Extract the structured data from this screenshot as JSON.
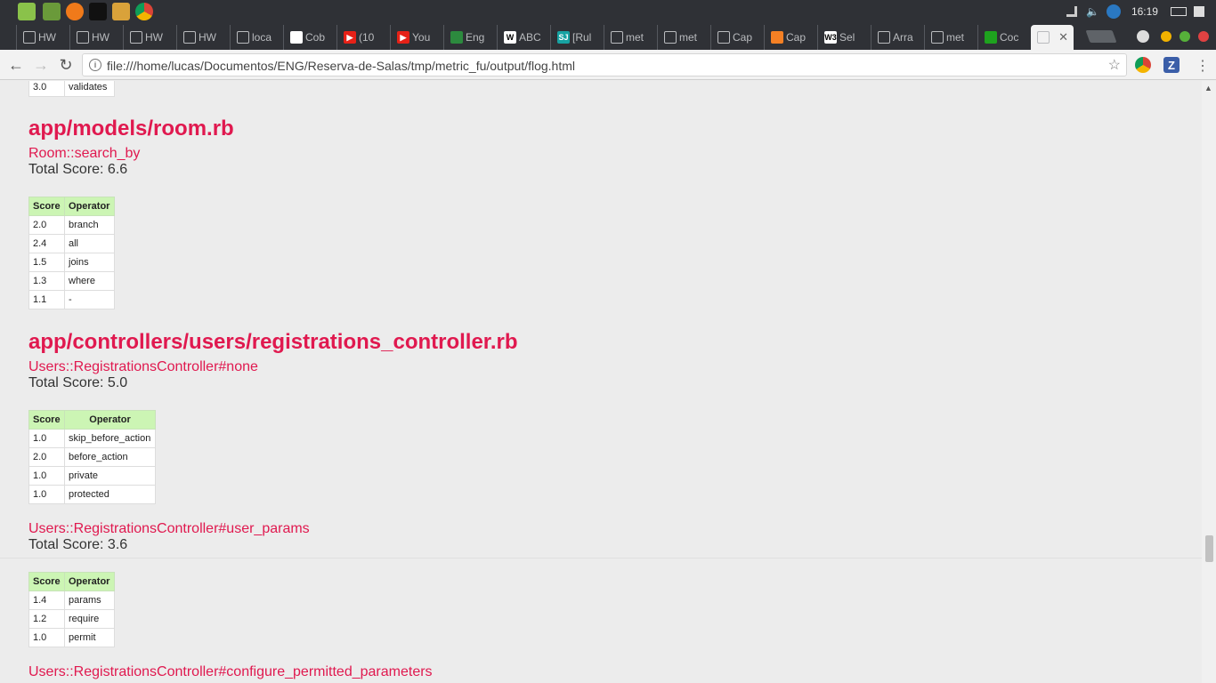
{
  "os": {
    "clock": "16:19",
    "apps": [
      "mint-menu-icon",
      "desktop-icon",
      "firefox-icon",
      "terminal-icon",
      "files-icon",
      "chrome-icon"
    ]
  },
  "tabs": [
    {
      "label": "HW",
      "icon": "doc-icon"
    },
    {
      "label": "HW",
      "icon": "doc-icon"
    },
    {
      "label": "HW",
      "icon": "doc-icon"
    },
    {
      "label": "HW",
      "icon": "doc-icon"
    },
    {
      "label": "loca",
      "icon": "doc-icon"
    },
    {
      "label": "Cob",
      "icon": "github-icon"
    },
    {
      "label": "(10",
      "icon": "youtube-icon"
    },
    {
      "label": "You",
      "icon": "youtube-icon"
    },
    {
      "label": "Eng",
      "icon": "flag-icon"
    },
    {
      "label": "ABC",
      "icon": "wikipedia-icon"
    },
    {
      "label": "[Rul",
      "icon": "sj-icon"
    },
    {
      "label": "met",
      "icon": "doc-icon"
    },
    {
      "label": "met",
      "icon": "doc-icon"
    },
    {
      "label": "Cap",
      "icon": "doc-icon"
    },
    {
      "label": "Cap",
      "icon": "stackoverflow-icon"
    },
    {
      "label": "Sel",
      "icon": "w3schools-icon"
    },
    {
      "label": "Arra",
      "icon": "doc-icon"
    },
    {
      "label": "met",
      "icon": "doc-icon"
    },
    {
      "label": "Coc",
      "icon": "green-square-icon"
    },
    {
      "label": "",
      "icon": "doc-icon"
    }
  ],
  "toolbar": {
    "url": "file:///home/lucas/Documentos/ENG/Reserva-de-Salas/tmp/metric_fu/output/flog.html"
  },
  "page": {
    "prev_row": {
      "score": "3.0",
      "operator": "validates"
    },
    "sections": [
      {
        "file": "app/models/room.rb",
        "methods": [
          {
            "name": "Room::search_by",
            "total": "Total Score: 6.6",
            "headers": [
              "Score",
              "Operator"
            ],
            "rows": [
              {
                "score": "2.0",
                "operator": "branch"
              },
              {
                "score": "2.4",
                "operator": "all"
              },
              {
                "score": "1.5",
                "operator": "joins"
              },
              {
                "score": "1.3",
                "operator": "where"
              },
              {
                "score": "1.1",
                "operator": "-"
              }
            ]
          }
        ]
      },
      {
        "file": "app/controllers/users/registrations_controller.rb",
        "methods": [
          {
            "name": "Users::RegistrationsController#none",
            "total": "Total Score: 5.0",
            "headers": [
              "Score",
              "Operator"
            ],
            "rows": [
              {
                "score": "1.0",
                "operator": "skip_before_action"
              },
              {
                "score": "2.0",
                "operator": "before_action"
              },
              {
                "score": "1.0",
                "operator": "private"
              },
              {
                "score": "1.0",
                "operator": "protected"
              }
            ]
          },
          {
            "name": "Users::RegistrationsController#user_params",
            "total": "Total Score: 3.6",
            "headers": [
              "Score",
              "Operator"
            ],
            "rows": [
              {
                "score": "1.4",
                "operator": "params"
              },
              {
                "score": "1.2",
                "operator": "require"
              },
              {
                "score": "1.0",
                "operator": "permit"
              }
            ]
          },
          {
            "name": "Users::RegistrationsController#configure_permitted_parameters"
          }
        ]
      }
    ]
  }
}
